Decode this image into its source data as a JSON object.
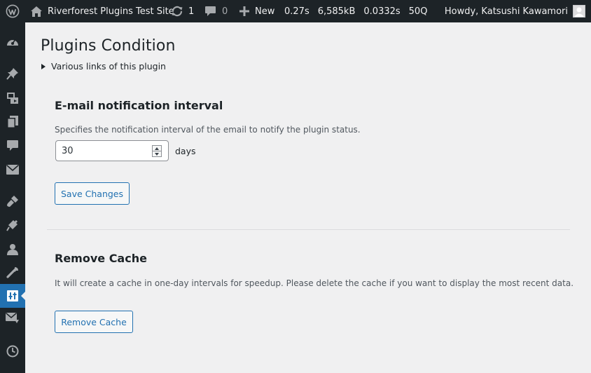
{
  "admin_bar": {
    "site_name": "Riverforest Plugins Test Site",
    "updates_count": "1",
    "comments_count": "0",
    "new_label": "New",
    "stats": {
      "time": "0.27s",
      "memory": "6,585kB",
      "query_time": "0.0332s",
      "queries": "50Q"
    },
    "greeting": "Howdy, Katsushi Kawamori"
  },
  "sidebar": {
    "icons": [
      "dashboard-icon",
      "posts-icon",
      "media-icon",
      "pages-icon",
      "comments-icon",
      "mail-icon",
      "appearance-icon",
      "plugins-icon",
      "users-icon",
      "tools-icon",
      "settings-icon",
      "mail-settings-icon",
      "clock-icon"
    ],
    "current": "settings-icon",
    "current_color": "#2271b1"
  },
  "page": {
    "title": "Plugins Condition",
    "details_summary": "Various links of this plugin"
  },
  "email_section": {
    "title": "E-mail notification interval",
    "description": "Specifies the notification interval of the email to notify the plugin status.",
    "interval_value": "30",
    "unit": "days",
    "save_label": "Save Changes"
  },
  "cache_section": {
    "title": "Remove Cache",
    "description": "It will create a cache in one-day intervals for speedup. Please delete the cache if you want to display the most recent data.",
    "button_label": "Remove Cache"
  },
  "colors": {
    "admin_bar_bg": "#1d2327",
    "accent": "#2271b1",
    "page_bg": "#f0f0f1"
  }
}
